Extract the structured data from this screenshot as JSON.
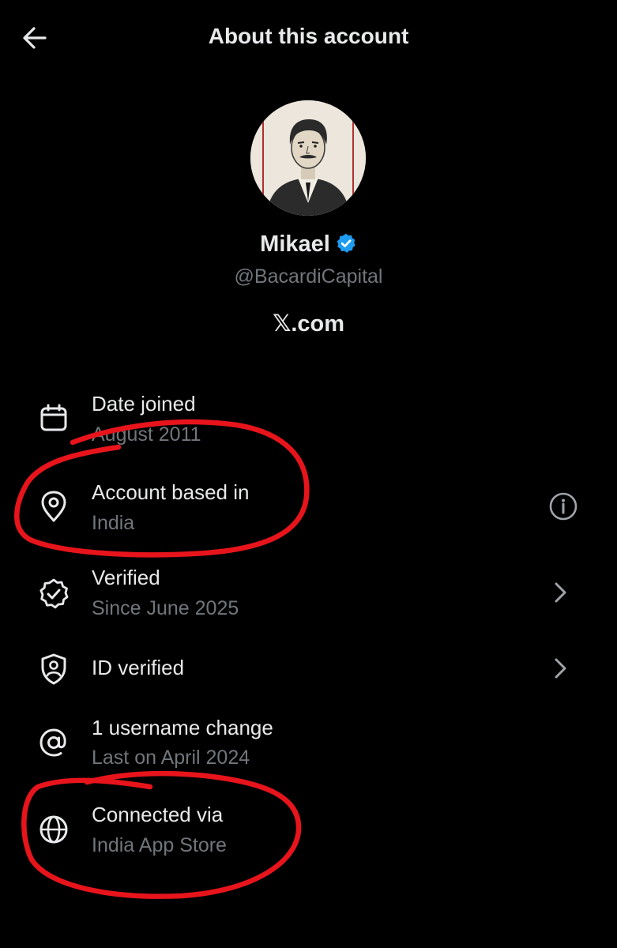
{
  "header": {
    "title": "About this account",
    "back_icon": "arrow-left-icon"
  },
  "profile": {
    "avatar_icon": "avatar-portrait",
    "name": "Mikael",
    "verified_badge_color": "#1d9bf0",
    "handle": "@BacardiCapital",
    "site": "𝕏.com"
  },
  "rows": [
    {
      "icon": "calendar-icon",
      "title": "Date joined",
      "subtitle": "August 2011"
    },
    {
      "icon": "location-pin-icon",
      "title": "Account based in",
      "subtitle": "India",
      "right_icon": "info-icon"
    },
    {
      "icon": "verified-check-icon",
      "title": "Verified",
      "subtitle": "Since June 2025",
      "right_icon": "chevron-right-icon"
    },
    {
      "icon": "id-shield-icon",
      "title": "ID verified",
      "right_icon": "chevron-right-icon"
    },
    {
      "icon": "at-sign-icon",
      "title": "1 username change",
      "subtitle": "Last on April 2024"
    },
    {
      "icon": "globe-icon",
      "title": "Connected via",
      "subtitle": "India App Store"
    }
  ],
  "colors": {
    "background": "#000000",
    "text": "#e7e9ea",
    "muted": "#71767b",
    "annotation": "#e8141c"
  }
}
